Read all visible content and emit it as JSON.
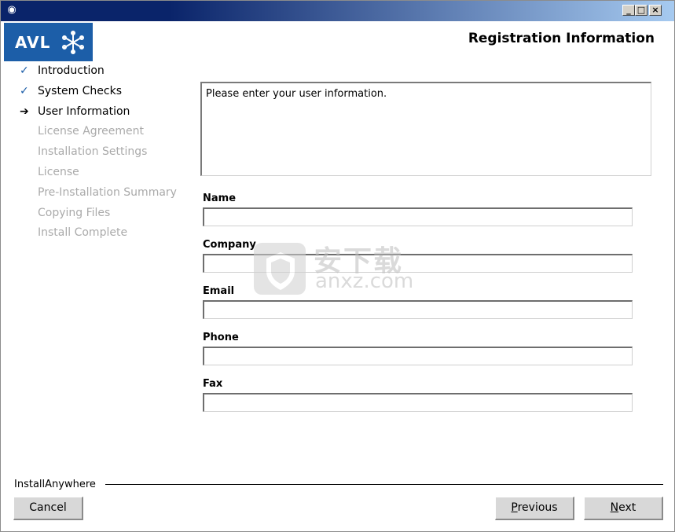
{
  "window": {
    "app_icon": "installer-icon",
    "controls": {
      "minimize": "_",
      "maximize": "□",
      "close": "×"
    }
  },
  "brand": {
    "logo_text": "AVL",
    "logo_icon": "snowflake-icon",
    "logo_color": "#1c5ea8"
  },
  "header": {
    "title": "Registration Information"
  },
  "steps": [
    {
      "label": "Introduction",
      "state": "done",
      "mark": "✓"
    },
    {
      "label": "System Checks",
      "state": "done",
      "mark": "✓"
    },
    {
      "label": "User Information",
      "state": "current",
      "mark": "➔"
    },
    {
      "label": "License Agreement",
      "state": "pending",
      "mark": ""
    },
    {
      "label": "Installation Settings",
      "state": "pending",
      "mark": ""
    },
    {
      "label": "License",
      "state": "pending",
      "mark": ""
    },
    {
      "label": "Pre-Installation Summary",
      "state": "pending",
      "mark": ""
    },
    {
      "label": "Copying Files",
      "state": "pending",
      "mark": ""
    },
    {
      "label": "Install Complete",
      "state": "pending",
      "mark": ""
    }
  ],
  "message": "Please enter your user information.",
  "form": {
    "name": {
      "label": "Name",
      "value": ""
    },
    "company": {
      "label": "Company",
      "value": ""
    },
    "email": {
      "label": "Email",
      "value": ""
    },
    "phone": {
      "label": "Phone",
      "value": ""
    },
    "fax": {
      "label": "Fax",
      "value": ""
    }
  },
  "watermark": {
    "cn_text": "安下载",
    "en_text": "anxz.com",
    "icon": "shield-icon"
  },
  "footer": {
    "brand": "InstallAnywhere",
    "cancel_label": "Cancel",
    "previous_label": {
      "accel": "P",
      "rest": "revious"
    },
    "next_label": {
      "accel": "N",
      "rest": "ext"
    }
  }
}
